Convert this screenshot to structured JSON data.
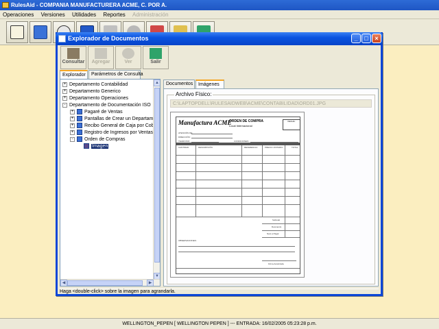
{
  "app": {
    "title": "RulesAid  - COMPANIA MANUFACTURERA ACME, C. POR A.",
    "menu": [
      "Operaciones",
      "Versiones",
      "Utilidades",
      "Reportes",
      "Administración"
    ]
  },
  "toolbar": {
    "icons": [
      "clipboard-icon",
      "document-icon",
      "disk-icon",
      "save-icon",
      "people-icon",
      "gears-icon",
      "edit-icon",
      "pencil-icon",
      "exit-door-icon"
    ]
  },
  "dialog": {
    "title": "Explorador de Documentos",
    "buttons": {
      "consultar": "Consultar",
      "agregar": "Agregar",
      "ver": "Ver",
      "salir": "Salir"
    },
    "left_tabs": [
      "Explorador",
      "Parámetros de Consulta"
    ],
    "tree": [
      {
        "label": "Departamento Contabilidad",
        "level": 0,
        "expander": "+"
      },
      {
        "label": "Departamento Generico",
        "level": 0,
        "expander": "+"
      },
      {
        "label": "Departamento Operaciones",
        "level": 0,
        "expander": "+"
      },
      {
        "label": "Departamento de Documentación ISO",
        "level": 0,
        "expander": "-"
      },
      {
        "label": "Pagaré de Ventas",
        "level": 1,
        "expander": "+"
      },
      {
        "label": "Pantallas de Crear un Departame",
        "level": 1,
        "expander": "+"
      },
      {
        "label": "Recibo General de Caja por Cob",
        "level": 1,
        "expander": "+"
      },
      {
        "label": "Registro de Ingresos por Ventas",
        "level": 1,
        "expander": "+"
      },
      {
        "label": "Orden de Compras",
        "level": 1,
        "expander": "-"
      },
      {
        "label": "Imagen",
        "level": 2,
        "expander": "",
        "selected": true
      }
    ],
    "right_tabs": [
      "Documentos",
      "Imágenes"
    ],
    "archivo_label": "Archivo Físico:",
    "archivo_path": "C:\\LAPTOPDELL\\RULESAIDWEB\\ACME\\CONTABILIDAD\\ORD01.JPG",
    "hint": "Haga <double-click> sobre la imagen para agrandarla."
  },
  "form_image": {
    "brand": "Manufactura ACME",
    "title": "ORDEN DE COMPRA",
    "subtitle": "Local   Internacional",
    "fields": [
      "ATENCIÓN DE:",
      "DIRECCIÓN:",
      "TELÉFONO:",
      "CONDICIONES:",
      "FECHA:"
    ],
    "columns": [
      "CANTIDAD",
      "DESCRIPCIÓN",
      "REFERENCIA",
      "PRECIO UNITARIO",
      "TOTAL"
    ],
    "totals": [
      "Subtotal",
      "Descuento",
      "Neto a Pagar"
    ],
    "observaciones": "OBSERVACIONES:",
    "firma": "Firma Autorizada"
  },
  "status": {
    "text": "WELLINGTON_PEPEN [ WELLINGTON PEPEN ] --- ENTRADA: 16/02/2005 05:23:28 p.m."
  }
}
